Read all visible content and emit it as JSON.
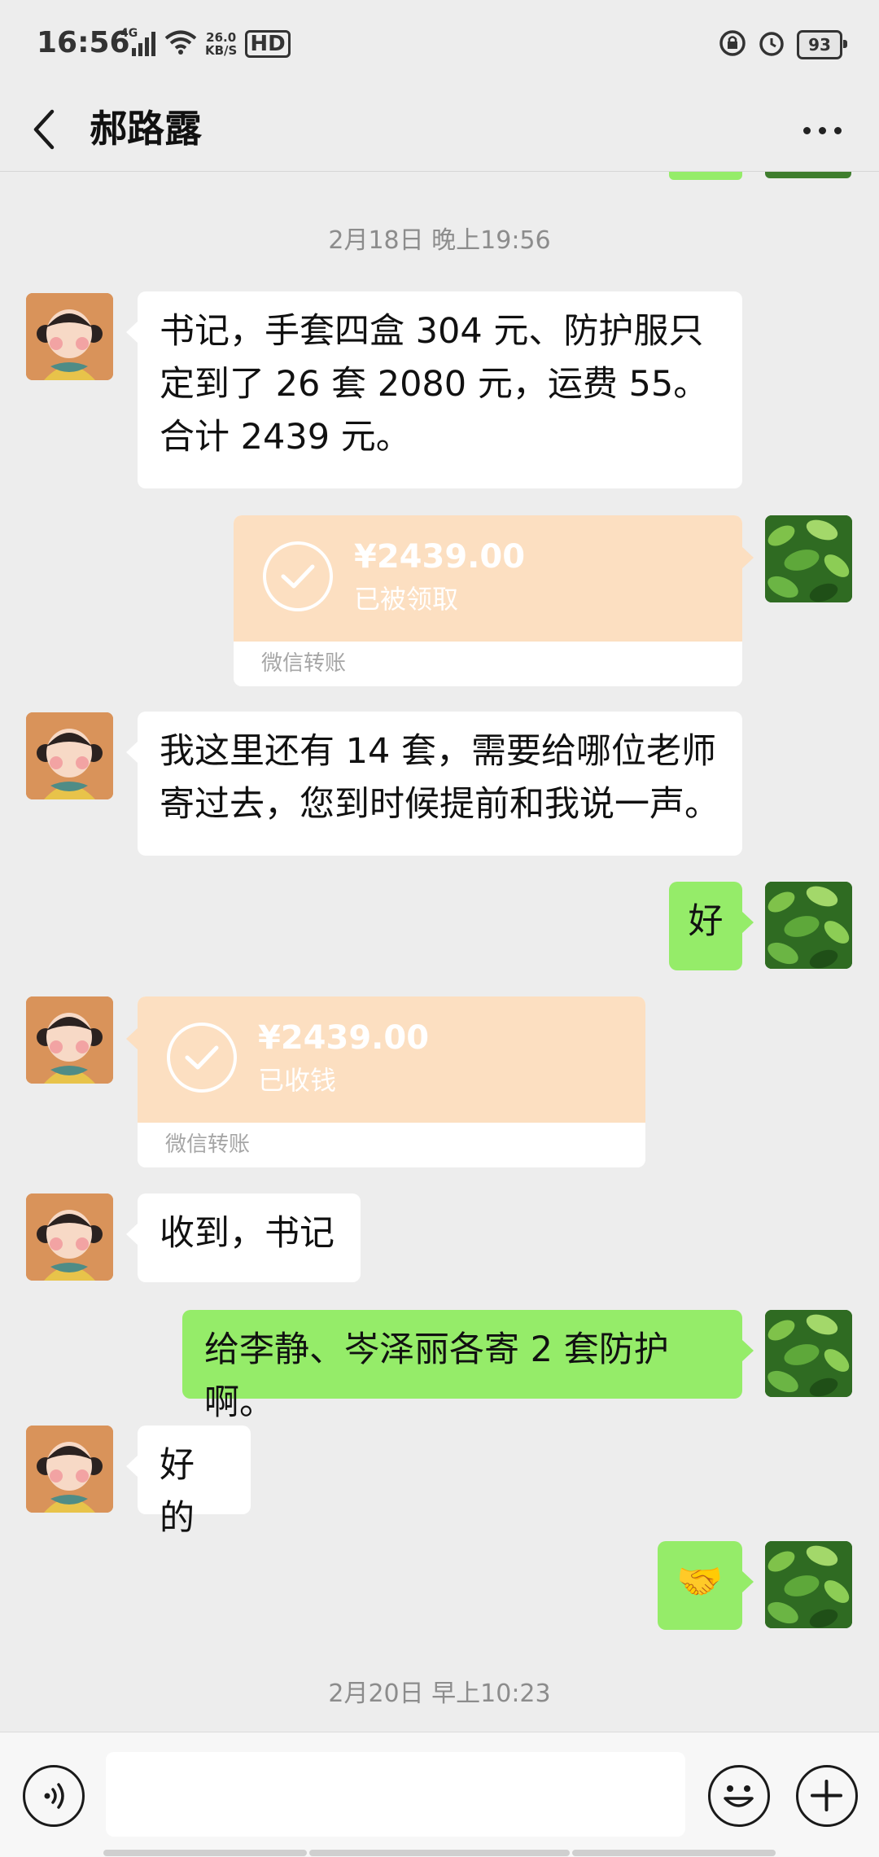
{
  "status_bar": {
    "time": "16:56",
    "network": "4G",
    "net_speed_value": "26.0",
    "net_speed_unit": "KB/S",
    "hd": "HD",
    "battery": "93"
  },
  "header": {
    "contact_name": "郝路露",
    "back_icon": "chevron-left-icon",
    "more_icon": "more-dots-icon"
  },
  "messages": [
    {
      "type": "timestamp",
      "text": "2月18日 晚上19:56"
    },
    {
      "type": "text",
      "from": "them",
      "text": "书记，手套四盒 304 元、防护服只定到了 26 套 2080 元，运费 55。合计 2439 元。"
    },
    {
      "type": "transfer",
      "from": "me",
      "amount": "¥2439.00",
      "status": "已被领取",
      "label": "微信转账"
    },
    {
      "type": "text",
      "from": "them",
      "text": "我这里还有 14 套，需要给哪位老师寄过去，您到时候提前和我说一声。"
    },
    {
      "type": "text",
      "from": "me",
      "text": "好"
    },
    {
      "type": "transfer",
      "from": "them",
      "amount": "¥2439.00",
      "status": "已收钱",
      "label": "微信转账"
    },
    {
      "type": "text",
      "from": "them",
      "text": "收到，书记"
    },
    {
      "type": "text",
      "from": "me",
      "text": "给李静、岑泽丽各寄 2 套防护啊。"
    },
    {
      "type": "text",
      "from": "them",
      "text": "好的"
    },
    {
      "type": "emoji",
      "from": "me",
      "text": "🤝"
    },
    {
      "type": "timestamp",
      "text": "2月20日 早上10:23"
    }
  ],
  "input_bar": {
    "voice_icon": "voice-icon",
    "input_value": "",
    "emoji_icon": "emoji-icon",
    "plus_icon": "plus-icon"
  },
  "colors": {
    "background": "#ededed",
    "outgoing_bubble": "#95ec69",
    "incoming_bubble": "#ffffff",
    "transfer_card": "#fcdfc1",
    "timestamp_text": "#8c8c8c"
  }
}
